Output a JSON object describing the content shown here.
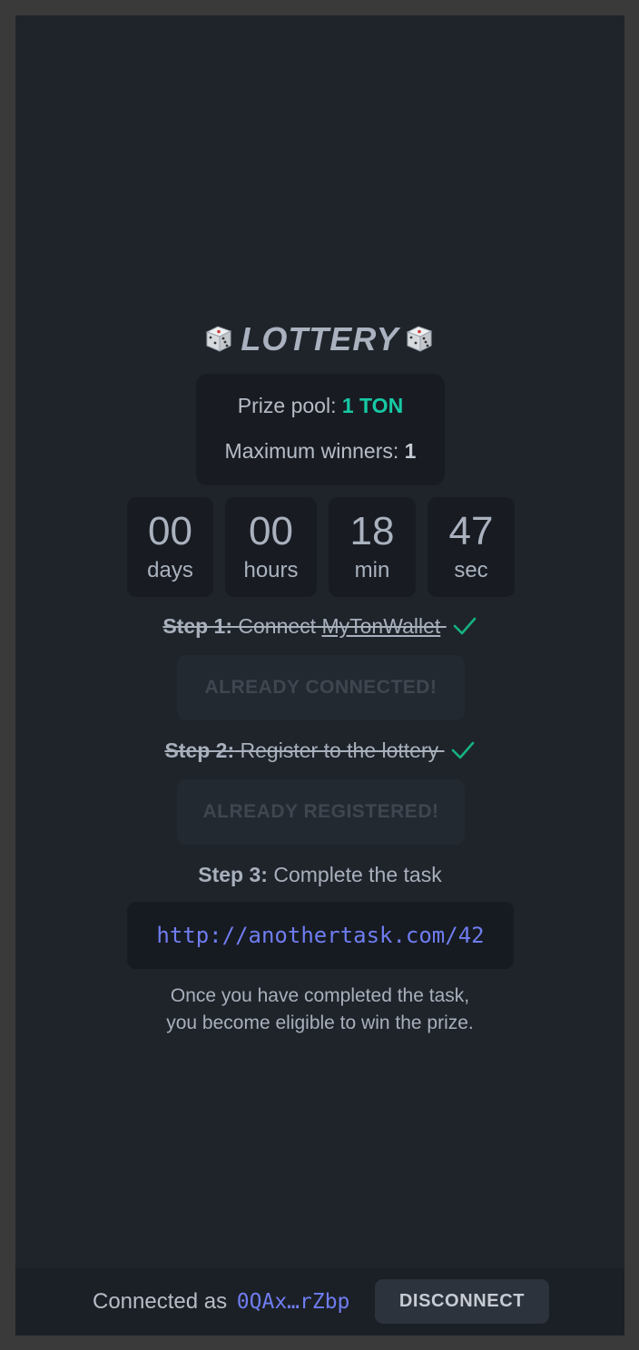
{
  "title": "LOTTERY",
  "prize": {
    "pool_label": "Prize pool:",
    "pool_value": "1 TON",
    "winners_label": "Maximum winners:",
    "winners_value": "1"
  },
  "countdown": [
    {
      "value": "00",
      "unit": "days"
    },
    {
      "value": "00",
      "unit": "hours"
    },
    {
      "value": "18",
      "unit": "min"
    },
    {
      "value": "47",
      "unit": "sec"
    }
  ],
  "steps": {
    "step1": {
      "label": "Step 1:",
      "text_prefix": "Connect",
      "link_text": "MyTonWallet",
      "button_label": "ALREADY CONNECTED!"
    },
    "step2": {
      "label": "Step 2:",
      "text": "Register to the lottery",
      "button_label": "ALREADY REGISTERED!"
    },
    "step3": {
      "label": "Step 3:",
      "text": "Complete the task",
      "task_url": "http://anothertask.com/42"
    }
  },
  "note": {
    "line1": "Once you have completed the task,",
    "line2": "you become eligible to win the prize."
  },
  "footer": {
    "connected_label": "Connected as",
    "address": "0QAx…rZbp",
    "disconnect_label": "DISCONNECT"
  },
  "colors": {
    "accent_teal": "#16c9a5",
    "link_blue": "#6f7df0",
    "check_green": "#16b37f",
    "background": "#1f242b"
  },
  "icons": {
    "title_left": "dice-icon",
    "title_right": "dice-icon",
    "step_done": "checkmark-icon"
  }
}
